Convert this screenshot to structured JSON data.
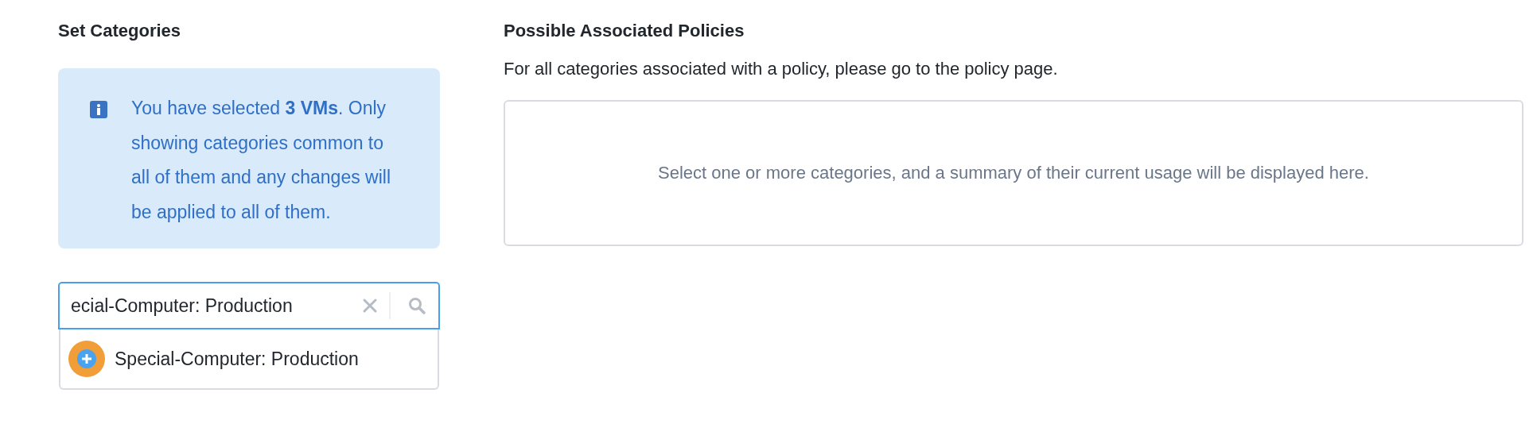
{
  "left": {
    "title": "Set Categories",
    "info": {
      "text": "You have selected **3 VMs**. Only showing categories common to all of them and any changes will be applied to all of them."
    },
    "search": {
      "value": "ecial-Computer: Production"
    },
    "results": [
      {
        "label": "Special-Computer: Production",
        "selected": false
      }
    ]
  },
  "right": {
    "title": "Possible Associated Policies",
    "subtitle": "For all categories associated with a policy, please go to the policy page.",
    "empty_message": "Select one or more categories, and a summary of their current usage will be displayed here."
  }
}
